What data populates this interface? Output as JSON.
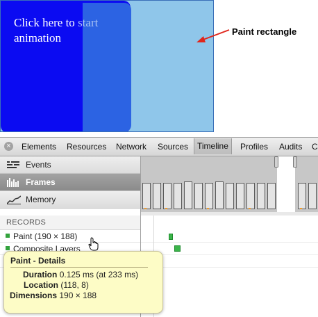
{
  "demo": {
    "text_part1": "Click here to ",
    "text_faded": "start",
    "text_part2": "animation",
    "callout": "Paint rectangle"
  },
  "colors": {
    "demo_background": "#8fc6ea",
    "animated_block": "#0b0bf2",
    "paint_rect": "#2c63e3",
    "event_bar": "#3bb54a",
    "tooltip_bg": "#fdfcc6"
  },
  "devtools": {
    "close_icon": "close-circle-icon",
    "tabs": [
      "Elements",
      "Resources",
      "Network",
      "Sources",
      "Timeline",
      "Profiles",
      "Audits",
      "C"
    ],
    "active_tab": "Timeline",
    "modes": [
      {
        "label": "Events",
        "icon": "events-icon"
      },
      {
        "label": "Frames",
        "icon": "frames-icon",
        "selected": true
      },
      {
        "label": "Memory",
        "icon": "memory-icon"
      }
    ],
    "records_title": "RECORDS",
    "records": [
      {
        "label": "Paint (190 × 188)",
        "color": "#33a33d"
      },
      {
        "label": "Composite Layers",
        "color": "#33a33d"
      }
    ]
  },
  "tooltip": {
    "title": "Paint - Details",
    "duration_label": "Duration",
    "duration_value": "0.125 ms (at 233 ms)",
    "location_label": "Location",
    "location_value": "(118, 8)",
    "dimensions_label": "Dimensions",
    "dimensions_value": "190 × 188"
  }
}
